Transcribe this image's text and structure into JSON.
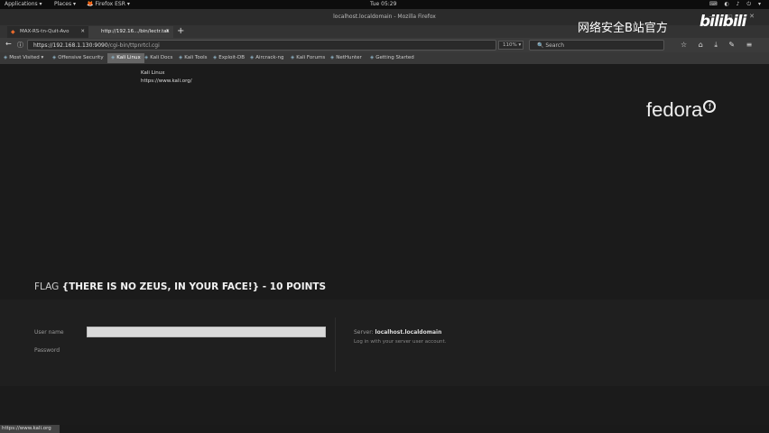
{
  "topbar": {
    "applications": "Applications ▾",
    "places": "Places ▾",
    "firefox": "🦊 Firefox ESR ▾",
    "clock": "Tue 05:29",
    "sys_icons": "⌨ ◐ ♪ ⏻ ▾"
  },
  "window": {
    "title": "localhost.localdomain - Mozilla Firefox",
    "controls": "– ▫ ✕"
  },
  "tabs": [
    {
      "label": "MAX-RS-tn-Quit-Avo",
      "close": "✕"
    },
    {
      "label": "http://192.16.../bin/lectr.tat",
      "close": "✕"
    }
  ],
  "new_tab": "+",
  "nav": {
    "back": "←",
    "info": "ⓘ",
    "url_prefix": "https://192.168.1.130:9090",
    "url_path": "/cgi-bin/ttpnrtcl.cgi",
    "zoom": "110% ▾",
    "search_placeholder": "🔍 Search",
    "toolbar_icons": "☆ ⌂ ⤓ ✎ ≡"
  },
  "bookmarks": [
    {
      "label": "Most Visited ▾"
    },
    {
      "label": "Offensive Security"
    },
    {
      "label": "Kali Linux"
    },
    {
      "label": "Kali Docs"
    },
    {
      "label": "Kali Tools"
    },
    {
      "label": "Exploit-DB"
    },
    {
      "label": "Aircrack-ng"
    },
    {
      "label": "Kali Forums"
    },
    {
      "label": "NetHunter"
    },
    {
      "label": "Getting Started"
    }
  ],
  "tooltip": {
    "title": "Kali Linux",
    "url": "https://www.kali.org/"
  },
  "watermark": {
    "text": "网络安全B站官方",
    "logo": "bilibili"
  },
  "page": {
    "brand": "fedora",
    "brand_mark": "f",
    "flag_prefix": "FLAG",
    "flag_text": "{THERE IS NO ZEUS, IN YOUR FACE!} - 10 POINTS",
    "login": {
      "username_label": "User name",
      "password_label": "Password",
      "username_value": "",
      "server_label": "Server:",
      "server_name": "localhost.localdomain",
      "hint": "Log in with your server user account."
    }
  },
  "status": {
    "url": "https://www.kali.org"
  }
}
